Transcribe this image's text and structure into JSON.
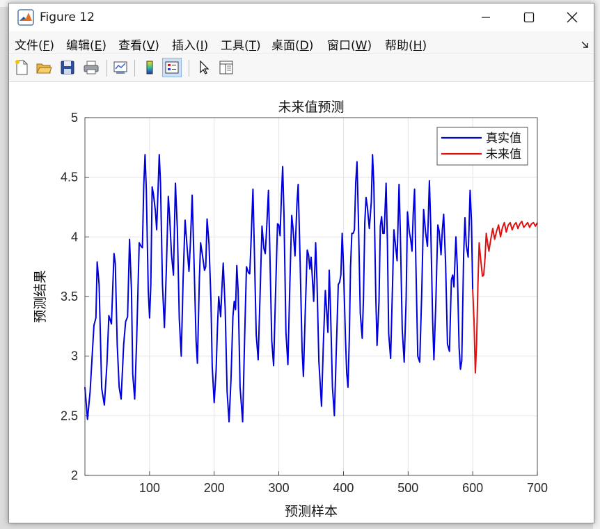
{
  "window": {
    "title": "Figure 12"
  },
  "menubar": {
    "items": [
      {
        "label": "文件(",
        "key": "F",
        "end": ")"
      },
      {
        "label": "编辑(",
        "key": "E",
        "end": ")"
      },
      {
        "label": "查看(",
        "key": "V",
        "end": ")"
      },
      {
        "label": "插入(",
        "key": "I",
        "end": ")"
      },
      {
        "label": "工具(",
        "key": "T",
        "end": ")"
      },
      {
        "label": "桌面(",
        "key": "D",
        "end": ")"
      },
      {
        "label": "窗口(",
        "key": "W",
        "end": ")"
      },
      {
        "label": "帮助(",
        "key": "H",
        "end": ")"
      }
    ]
  },
  "toolbar": {
    "buttons": [
      "new-figure-icon",
      "open-file-icon",
      "save-icon",
      "print-icon",
      "link-plot-icon",
      "colorbar-icon",
      "legend-icon",
      "edit-plot-arrow-icon",
      "property-inspector-icon"
    ]
  },
  "chart_data": {
    "type": "line",
    "title": "未来值预测",
    "xlabel": "预测样本",
    "ylabel": "预测结果",
    "xlim": [
      0,
      700
    ],
    "ylim": [
      2,
      5
    ],
    "xticks": [
      100,
      200,
      300,
      400,
      500,
      600,
      700
    ],
    "yticks": [
      2,
      2.5,
      3,
      3.5,
      4,
      4.5,
      5
    ],
    "grid": true,
    "legend_position": "top-right",
    "series": [
      {
        "name": "真实值",
        "color": "#0000dd",
        "points": [
          [
            0,
            2.74
          ],
          [
            4,
            2.47
          ],
          [
            8,
            2.7
          ],
          [
            14,
            3.26
          ],
          [
            17,
            3.32
          ],
          [
            19,
            3.79
          ],
          [
            22,
            3.6
          ],
          [
            26,
            2.73
          ],
          [
            30,
            2.59
          ],
          [
            34,
            2.93
          ],
          [
            37,
            3.34
          ],
          [
            41,
            3.27
          ],
          [
            43,
            3.56
          ],
          [
            45,
            3.86
          ],
          [
            47,
            3.78
          ],
          [
            50,
            3.1
          ],
          [
            53,
            2.74
          ],
          [
            56,
            2.64
          ],
          [
            60,
            3.1
          ],
          [
            63,
            3.29
          ],
          [
            66,
            3.33
          ],
          [
            69,
            3.98
          ],
          [
            72,
            3.55
          ],
          [
            74,
            2.85
          ],
          [
            77,
            2.64
          ],
          [
            80,
            3.13
          ],
          [
            84,
            3.95
          ],
          [
            87,
            3.92
          ],
          [
            89,
            3.91
          ],
          [
            91,
            4.43
          ],
          [
            93,
            4.69
          ],
          [
            95,
            4.4
          ],
          [
            98,
            3.55
          ],
          [
            100,
            3.32
          ],
          [
            102,
            3.6
          ],
          [
            104,
            4.42
          ],
          [
            106,
            4.36
          ],
          [
            109,
            4.22
          ],
          [
            111,
            4.06
          ],
          [
            113,
            4.37
          ],
          [
            115,
            4.69
          ],
          [
            117,
            4.45
          ],
          [
            120,
            3.6
          ],
          [
            123,
            3.24
          ],
          [
            126,
            3.73
          ],
          [
            129,
            4.34
          ],
          [
            131,
            4.18
          ],
          [
            134,
            3.85
          ],
          [
            137,
            3.68
          ],
          [
            140,
            4.45
          ],
          [
            143,
            4.07
          ],
          [
            146,
            3.31
          ],
          [
            149,
            3.0
          ],
          [
            152,
            3.65
          ],
          [
            155,
            4.14
          ],
          [
            158,
            3.92
          ],
          [
            161,
            3.71
          ],
          [
            163,
            3.93
          ],
          [
            166,
            4.35
          ],
          [
            169,
            3.76
          ],
          [
            172,
            3.13
          ],
          [
            174,
            2.94
          ],
          [
            177,
            3.64
          ],
          [
            179,
            3.95
          ],
          [
            182,
            3.84
          ],
          [
            185,
            3.72
          ],
          [
            187,
            3.75
          ],
          [
            189,
            4.15
          ],
          [
            192,
            3.94
          ],
          [
            195,
            3.46
          ],
          [
            197,
            2.91
          ],
          [
            200,
            2.61
          ],
          [
            203,
            2.88
          ],
          [
            205,
            3.24
          ],
          [
            207,
            3.5
          ],
          [
            210,
            3.33
          ],
          [
            212,
            3.58
          ],
          [
            214,
            3.78
          ],
          [
            217,
            3.4
          ],
          [
            220,
            2.7
          ],
          [
            223,
            2.45
          ],
          [
            226,
            2.81
          ],
          [
            229,
            3.33
          ],
          [
            231,
            3.46
          ],
          [
            233,
            3.39
          ],
          [
            235,
            3.76
          ],
          [
            237,
            3.55
          ],
          [
            240,
            2.74
          ],
          [
            244,
            2.45
          ],
          [
            247,
            3.14
          ],
          [
            250,
            3.75
          ],
          [
            253,
            3.7
          ],
          [
            255,
            3.69
          ],
          [
            257,
            3.95
          ],
          [
            260,
            4.4
          ],
          [
            262,
            3.92
          ],
          [
            265,
            3.18
          ],
          [
            268,
            2.97
          ],
          [
            271,
            3.51
          ],
          [
            274,
            4.09
          ],
          [
            277,
            3.9
          ],
          [
            279,
            3.86
          ],
          [
            281,
            4.05
          ],
          [
            284,
            4.39
          ],
          [
            286,
            3.9
          ],
          [
            289,
            3.13
          ],
          [
            292,
            2.92
          ],
          [
            295,
            3.53
          ],
          [
            298,
            4.11
          ],
          [
            300,
            4.1
          ],
          [
            302,
            4.01
          ],
          [
            304,
            4.34
          ],
          [
            306,
            4.59
          ],
          [
            308,
            4.19
          ],
          [
            311,
            3.2
          ],
          [
            314,
            2.93
          ],
          [
            317,
            3.6
          ],
          [
            320,
            4.18
          ],
          [
            322,
            4.07
          ],
          [
            325,
            3.84
          ],
          [
            328,
            4.28
          ],
          [
            330,
            4.44
          ],
          [
            333,
            3.79
          ],
          [
            336,
            3.05
          ],
          [
            338,
            2.83
          ],
          [
            341,
            3.38
          ],
          [
            344,
            3.89
          ],
          [
            346,
            3.85
          ],
          [
            348,
            3.73
          ],
          [
            350,
            3.83
          ],
          [
            352,
            3.64
          ],
          [
            354,
            3.46
          ],
          [
            357,
            3.95
          ],
          [
            359,
            3.63
          ],
          [
            362,
            2.96
          ],
          [
            366,
            2.58
          ],
          [
            369,
            3.11
          ],
          [
            372,
            3.55
          ],
          [
            374,
            3.38
          ],
          [
            376,
            3.2
          ],
          [
            378,
            3.72
          ],
          [
            380,
            3.38
          ],
          [
            383,
            2.74
          ],
          [
            386,
            2.5
          ],
          [
            389,
            3.06
          ],
          [
            392,
            3.6
          ],
          [
            394,
            3.62
          ],
          [
            396,
            3.68
          ],
          [
            398,
            4.03
          ],
          [
            400,
            3.77
          ],
          [
            403,
            3.17
          ],
          [
            405,
            2.86
          ],
          [
            407,
            2.74
          ],
          [
            409,
            3.14
          ],
          [
            411,
            3.75
          ],
          [
            413,
            4.03
          ],
          [
            415,
            4.03
          ],
          [
            417,
            4.06
          ],
          [
            419,
            4.46
          ],
          [
            421,
            4.63
          ],
          [
            423,
            4.18
          ],
          [
            426,
            3.36
          ],
          [
            429,
            3.15
          ],
          [
            431,
            3.49
          ],
          [
            433,
            4.12
          ],
          [
            435,
            4.33
          ],
          [
            437,
            4.25
          ],
          [
            440,
            4.07
          ],
          [
            443,
            4.29
          ],
          [
            445,
            4.69
          ],
          [
            447,
            4.44
          ],
          [
            450,
            3.5
          ],
          [
            452,
            3.09
          ],
          [
            455,
            3.46
          ],
          [
            457,
            4.09
          ],
          [
            459,
            4.17
          ],
          [
            461,
            4.03
          ],
          [
            463,
            4.03
          ],
          [
            466,
            4.45
          ],
          [
            468,
            3.95
          ],
          [
            470,
            3.19
          ],
          [
            473,
            2.98
          ],
          [
            476,
            3.61
          ],
          [
            478,
            4.06
          ],
          [
            480,
            3.96
          ],
          [
            483,
            3.8
          ],
          [
            486,
            4.44
          ],
          [
            488,
            4.05
          ],
          [
            491,
            3.22
          ],
          [
            494,
            2.95
          ],
          [
            497,
            3.48
          ],
          [
            499,
            4.21
          ],
          [
            502,
            4.04
          ],
          [
            504,
            3.98
          ],
          [
            506,
            3.88
          ],
          [
            508,
            4.2
          ],
          [
            510,
            4.4
          ],
          [
            512,
            3.8
          ],
          [
            515,
            3.0
          ],
          [
            518,
            2.95
          ],
          [
            521,
            3.51
          ],
          [
            524,
            4.23
          ],
          [
            527,
            4.04
          ],
          [
            530,
            3.92
          ],
          [
            533,
            4.47
          ],
          [
            535,
            4.1
          ],
          [
            538,
            3.29
          ],
          [
            540,
            2.97
          ],
          [
            543,
            3.46
          ],
          [
            546,
            4.1
          ],
          [
            548,
            4.05
          ],
          [
            551,
            3.85
          ],
          [
            553,
            4.06
          ],
          [
            555,
            4.19
          ],
          [
            558,
            3.79
          ],
          [
            561,
            3.1
          ],
          [
            564,
            3.04
          ],
          [
            567,
            3.64
          ],
          [
            569,
            3.68
          ],
          [
            571,
            3.58
          ],
          [
            574,
            4.0
          ],
          [
            576,
            3.76
          ],
          [
            579,
            3.07
          ],
          [
            581,
            2.89
          ],
          [
            583,
            2.96
          ],
          [
            586,
            3.85
          ],
          [
            588,
            4.16
          ],
          [
            590,
            3.93
          ],
          [
            593,
            3.83
          ],
          [
            596,
            4.39
          ],
          [
            598,
            4.14
          ],
          [
            600,
            3.56
          ]
        ]
      },
      {
        "name": "未来值",
        "color": "#dd1111",
        "points": [
          [
            600,
            3.56
          ],
          [
            602,
            3.3
          ],
          [
            604,
            2.86
          ],
          [
            606,
            3.1
          ],
          [
            608,
            3.6
          ],
          [
            610,
            3.95
          ],
          [
            612,
            3.83
          ],
          [
            615,
            3.67
          ],
          [
            617,
            3.68
          ],
          [
            619,
            3.82
          ],
          [
            621,
            4.03
          ],
          [
            623,
            3.95
          ],
          [
            625,
            3.88
          ],
          [
            628,
            3.98
          ],
          [
            631,
            4.07
          ],
          [
            634,
            3.98
          ],
          [
            637,
            4.05
          ],
          [
            640,
            4.1
          ],
          [
            643,
            4.0
          ],
          [
            646,
            4.08
          ],
          [
            649,
            4.12
          ],
          [
            652,
            4.04
          ],
          [
            655,
            4.1
          ],
          [
            658,
            4.12
          ],
          [
            661,
            4.06
          ],
          [
            664,
            4.1
          ],
          [
            667,
            4.12
          ],
          [
            670,
            4.07
          ],
          [
            673,
            4.11
          ],
          [
            676,
            4.13
          ],
          [
            679,
            4.08
          ],
          [
            682,
            4.1
          ],
          [
            685,
            4.12
          ],
          [
            688,
            4.08
          ],
          [
            691,
            4.11
          ],
          [
            694,
            4.12
          ],
          [
            697,
            4.09
          ],
          [
            700,
            4.12
          ]
        ]
      }
    ]
  }
}
